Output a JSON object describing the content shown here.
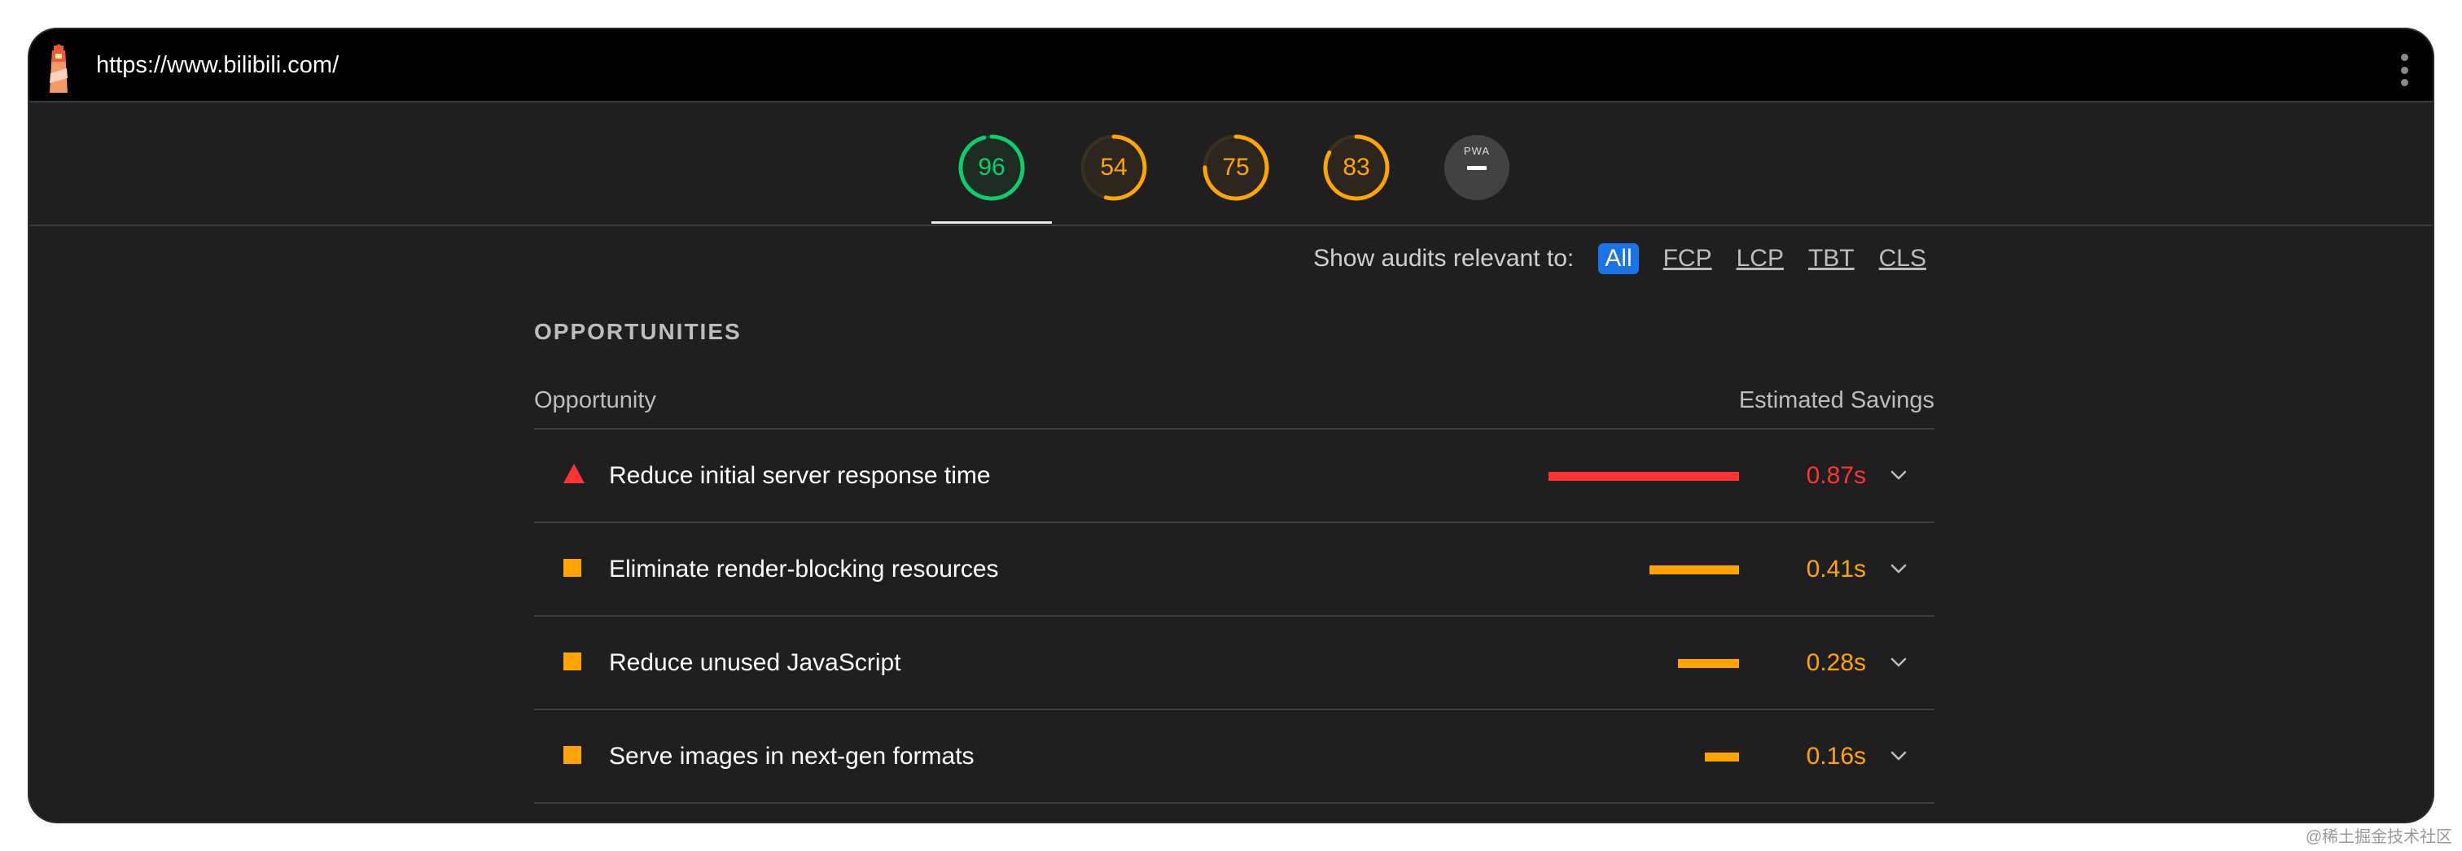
{
  "topbar": {
    "url": "https://www.bilibili.com/"
  },
  "gauges": [
    {
      "name": "gauge-performance",
      "value": "96",
      "fraction": 0.96,
      "color": "#0cce6b",
      "bg": "#1e3b2b"
    },
    {
      "name": "gauge-accessibility",
      "value": "54",
      "fraction": 0.54,
      "color": "#ffa400",
      "bg": "#3b2f1d"
    },
    {
      "name": "gauge-best-practices",
      "value": "75",
      "fraction": 0.75,
      "color": "#ffa400",
      "bg": "#3b2f1d"
    },
    {
      "name": "gauge-seo",
      "value": "83",
      "fraction": 0.83,
      "color": "#ffa400",
      "bg": "#3b2f1d"
    }
  ],
  "pwa": {
    "label": "PWA"
  },
  "filter": {
    "label": "Show audits relevant to:",
    "chips": [
      "All",
      "FCP",
      "LCP",
      "TBT",
      "CLS"
    ],
    "active": "All"
  },
  "section": {
    "title": "OPPORTUNITIES"
  },
  "table": {
    "col_left": "Opportunity",
    "col_right": "Estimated Savings",
    "rows": [
      {
        "title": "Reduce initial server response time",
        "savings": "0.87s",
        "savings_fraction": 1.0,
        "severity": "fail",
        "color": "#ff3333"
      },
      {
        "title": "Eliminate render-blocking resources",
        "savings": "0.41s",
        "savings_fraction": 0.47,
        "severity": "average",
        "color": "#ffa400"
      },
      {
        "title": "Reduce unused JavaScript",
        "savings": "0.28s",
        "savings_fraction": 0.32,
        "severity": "average",
        "color": "#ffa400"
      },
      {
        "title": "Serve images in next-gen formats",
        "savings": "0.16s",
        "savings_fraction": 0.18,
        "severity": "average",
        "color": "#ffa400"
      }
    ]
  },
  "watermark": "@稀土掘金技术社区"
}
